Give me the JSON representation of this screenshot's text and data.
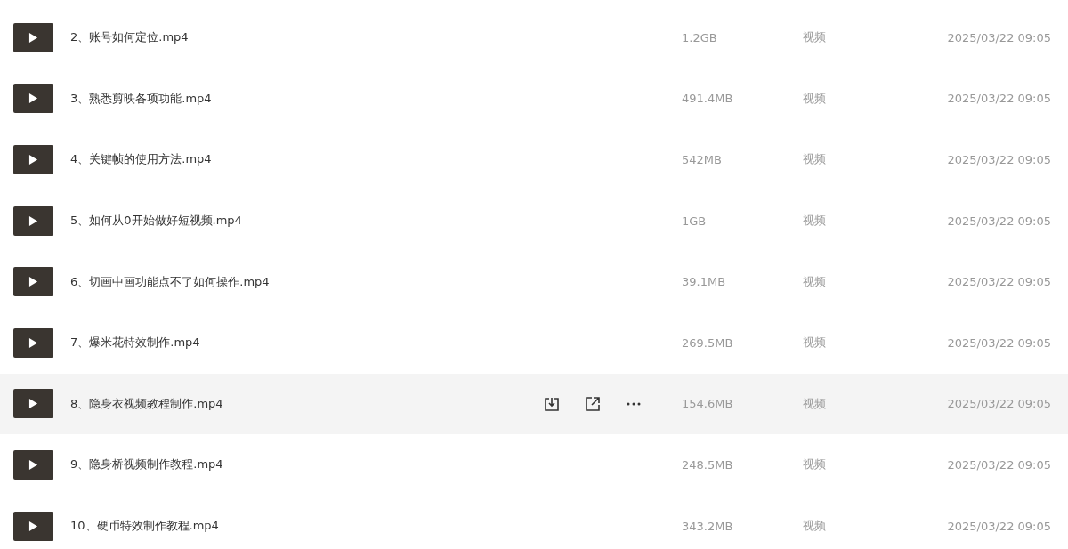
{
  "files": [
    {
      "name": "2、账号如何定位.mp4",
      "size": "1.2GB",
      "type": "视频",
      "modified": "2025/03/22 09:05",
      "hovered": false
    },
    {
      "name": "3、熟悉剪映各项功能.mp4",
      "size": "491.4MB",
      "type": "视频",
      "modified": "2025/03/22 09:05",
      "hovered": false
    },
    {
      "name": "4、关键帧的使用方法.mp4",
      "size": "542MB",
      "type": "视频",
      "modified": "2025/03/22 09:05",
      "hovered": false
    },
    {
      "name": "5、如何从0开始做好短视频.mp4",
      "size": "1GB",
      "type": "视频",
      "modified": "2025/03/22 09:05",
      "hovered": false
    },
    {
      "name": "6、切画中画功能点不了如何操作.mp4",
      "size": "39.1MB",
      "type": "视频",
      "modified": "2025/03/22 09:05",
      "hovered": false
    },
    {
      "name": "7、爆米花特效制作.mp4",
      "size": "269.5MB",
      "type": "视频",
      "modified": "2025/03/22 09:05",
      "hovered": false
    },
    {
      "name": "8、隐身衣视频教程制作.mp4",
      "size": "154.6MB",
      "type": "视频",
      "modified": "2025/03/22 09:05",
      "hovered": true
    },
    {
      "name": "9、隐身桥视频制作教程.mp4",
      "size": "248.5MB",
      "type": "视频",
      "modified": "2025/03/22 09:05",
      "hovered": false
    },
    {
      "name": "10、硬币特效制作教程.mp4",
      "size": "343.2MB",
      "type": "视频",
      "modified": "2025/03/22 09:05",
      "hovered": false
    }
  ]
}
